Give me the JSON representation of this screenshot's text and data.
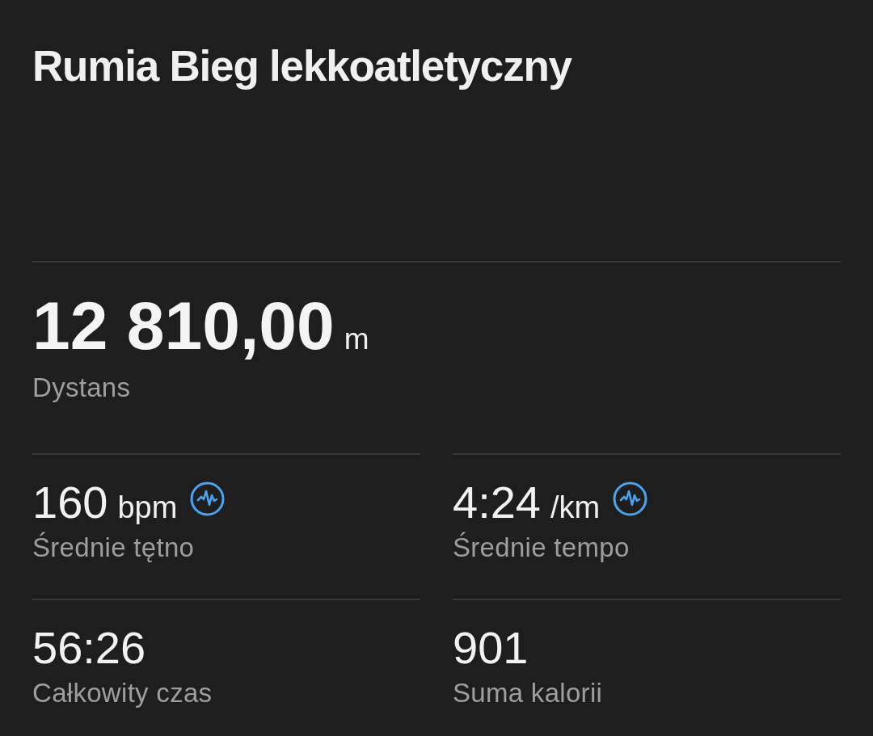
{
  "title": "Rumia Bieg lekkoatletyczny",
  "primary_stat": {
    "value": "12 810,00",
    "unit": "m",
    "label": "Dystans"
  },
  "stats": [
    {
      "value": "160",
      "unit": "bpm",
      "label": "Średnie tętno",
      "graph_icon": true
    },
    {
      "value": "4:24",
      "unit": "/km",
      "label": "Średnie tempo",
      "graph_icon": true
    },
    {
      "value": "56:26",
      "label": "Całkowity czas",
      "graph_icon": false
    },
    {
      "value": "901",
      "label": "Suma kalorii",
      "graph_icon": false
    }
  ]
}
